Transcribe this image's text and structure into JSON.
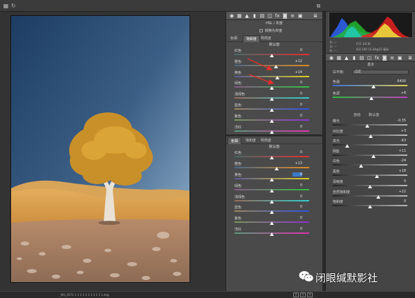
{
  "hsl": {
    "title": "HSL / 灰度",
    "gray_toggle": "转换为灰度",
    "tabs": [
      "色相",
      "饱和度",
      "明亮度"
    ],
    "active_tab": 1,
    "default_label": "默认值",
    "sliders": [
      {
        "name": "红色",
        "value": "0",
        "level": 0
      },
      {
        "name": "橙色",
        "value": "+12",
        "level": 12
      },
      {
        "name": "黄色",
        "value": "+14",
        "level": 14
      },
      {
        "name": "绿色",
        "value": "0",
        "level": 0
      },
      {
        "name": "浅绿色",
        "value": "0",
        "level": 0
      },
      {
        "name": "蓝色",
        "value": "0",
        "level": 0
      },
      {
        "name": "紫色",
        "value": "0",
        "level": 0
      },
      {
        "name": "洋红",
        "value": "0",
        "level": 0
      }
    ]
  },
  "hsl2": {
    "tabs": [
      "色相",
      "饱和度",
      "明亮度"
    ],
    "active_tab": 0,
    "default_label": "默认值",
    "sliders": [
      {
        "name": "红色",
        "value": "0",
        "level": 0,
        "highlight": false
      },
      {
        "name": "橙色",
        "value": "+13",
        "level": 13,
        "highlight": false
      },
      {
        "name": "黄色",
        "value": "0",
        "level": 0,
        "highlight": true
      },
      {
        "name": "绿色",
        "value": "0",
        "level": 0,
        "highlight": false
      },
      {
        "name": "浅绿色",
        "value": "0",
        "level": 0,
        "highlight": false
      },
      {
        "name": "蓝色",
        "value": "0",
        "level": 0,
        "highlight": false
      },
      {
        "name": "紫色",
        "value": "0",
        "level": 0,
        "highlight": false
      },
      {
        "name": "洋红",
        "value": "0",
        "level": 0,
        "highlight": false
      }
    ]
  },
  "camera_info": {
    "r": "R: ---",
    "g": "G: ---",
    "b": "B: ---",
    "exposure": "f/11  1/6 秒",
    "iso": "ISO 100  15-24@15 毫米"
  },
  "basic": {
    "title": "基本",
    "wb_label": "白平衡:",
    "wb_value": "自定",
    "auto": "自动",
    "default": "默认值",
    "sliders_top": [
      {
        "name": "色温",
        "value": "6400",
        "level": 0.55
      },
      {
        "name": "色调",
        "value": "+8",
        "level": 0.52
      }
    ],
    "sliders_mid": [
      {
        "name": "曝光",
        "value": "-0.35",
        "level": 0.46
      },
      {
        "name": "对比度",
        "value": "+3",
        "level": 0.51
      },
      {
        "name": "高光",
        "value": "-63",
        "level": 0.19
      },
      {
        "name": "阴影",
        "value": "+11",
        "level": 0.55
      },
      {
        "name": "白色",
        "value": "-24",
        "level": 0.38
      },
      {
        "name": "黑色",
        "value": "+18",
        "level": 0.59
      }
    ],
    "sliders_bottom": [
      {
        "name": "清晰度",
        "value": "0",
        "level": 0.5
      },
      {
        "name": "自然饱和度",
        "value": "+22",
        "level": 0.61
      },
      {
        "name": "饱和度",
        "value": "0",
        "level": 0.5
      }
    ]
  },
  "file_name": "_MG_0571 1 1 1 1 1 1 1 1 1 1 1.dng",
  "bottom_buttons": [
    "Y",
    "Y",
    "Y"
  ],
  "watermark": "闭眼缄默影社",
  "colors": {
    "accent": "#3b7ac8",
    "arrow": "#e0302a"
  },
  "icons": {
    "top_left_1": "grid-icon",
    "top_left_2": "rotate-icon",
    "top_right": "fullscreen-icon"
  }
}
